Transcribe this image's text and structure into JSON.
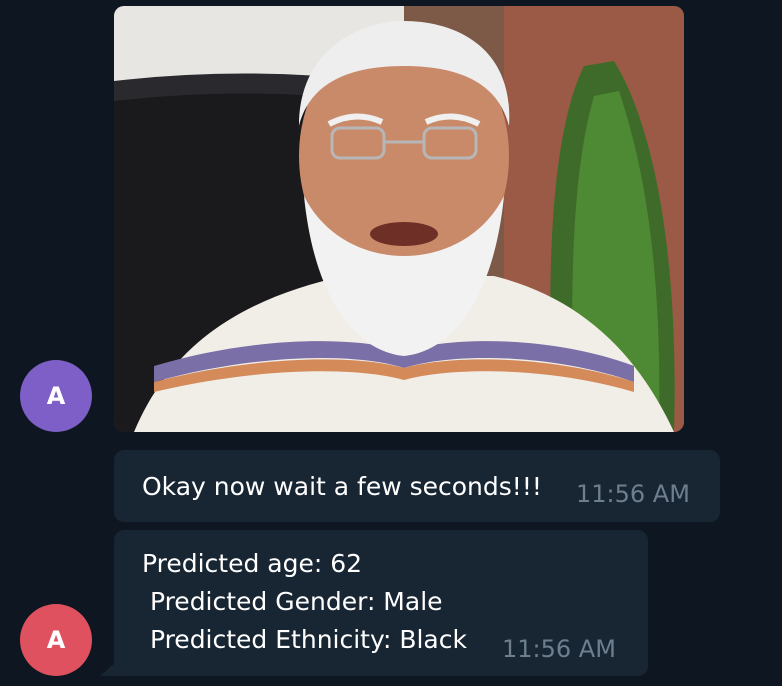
{
  "chat": {
    "messages": [
      {
        "sender_initial": "A",
        "avatar_color": "#7e5fc7",
        "type": "photo",
        "photo_description_icon": "portrait-photo"
      },
      {
        "type": "text",
        "text": "Okay now wait a few seconds!!!",
        "time": "11:56 AM"
      },
      {
        "sender_initial": "A",
        "avatar_color": "#e0515f",
        "type": "text",
        "lines": [
          "Predicted age: 62",
          " Predicted Gender: Male",
          " Predicted Ethnicity: Black"
        ],
        "time": "11:56 AM"
      }
    ]
  },
  "colors": {
    "background": "#0e1621",
    "bubble": "#182533",
    "timestamp": "#6d7f8f"
  }
}
